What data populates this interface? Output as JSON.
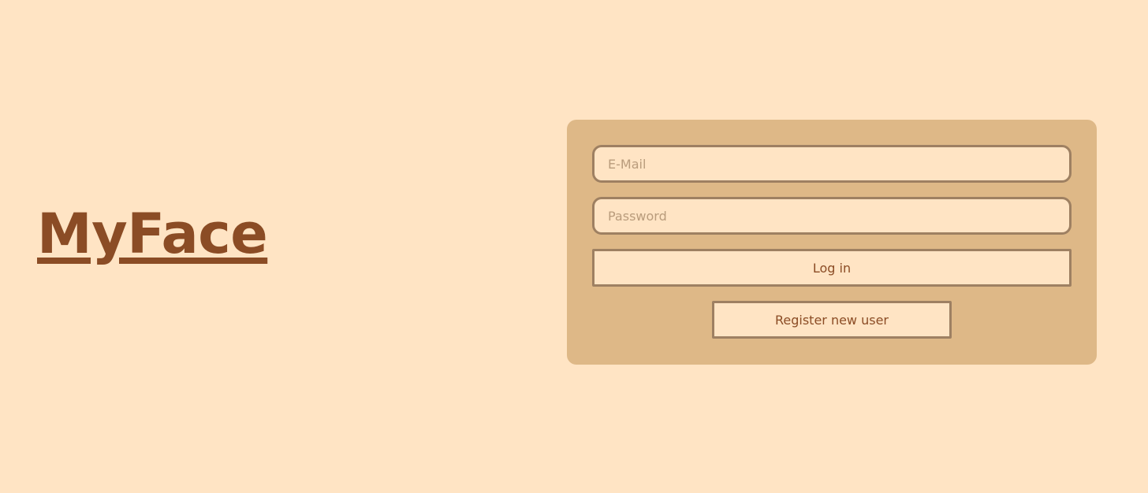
{
  "brand": {
    "title": "MyFace"
  },
  "login_form": {
    "email_placeholder": "E-Mail",
    "email_value": "",
    "password_placeholder": "Password",
    "password_value": "",
    "login_label": "Log in",
    "register_label": "Register new user"
  },
  "colors": {
    "page_background": "#ffe4c4",
    "card_background": "#deb887",
    "brand_text": "#8b4c25",
    "border": "#9e8062",
    "placeholder_text": "#b99c7c"
  }
}
